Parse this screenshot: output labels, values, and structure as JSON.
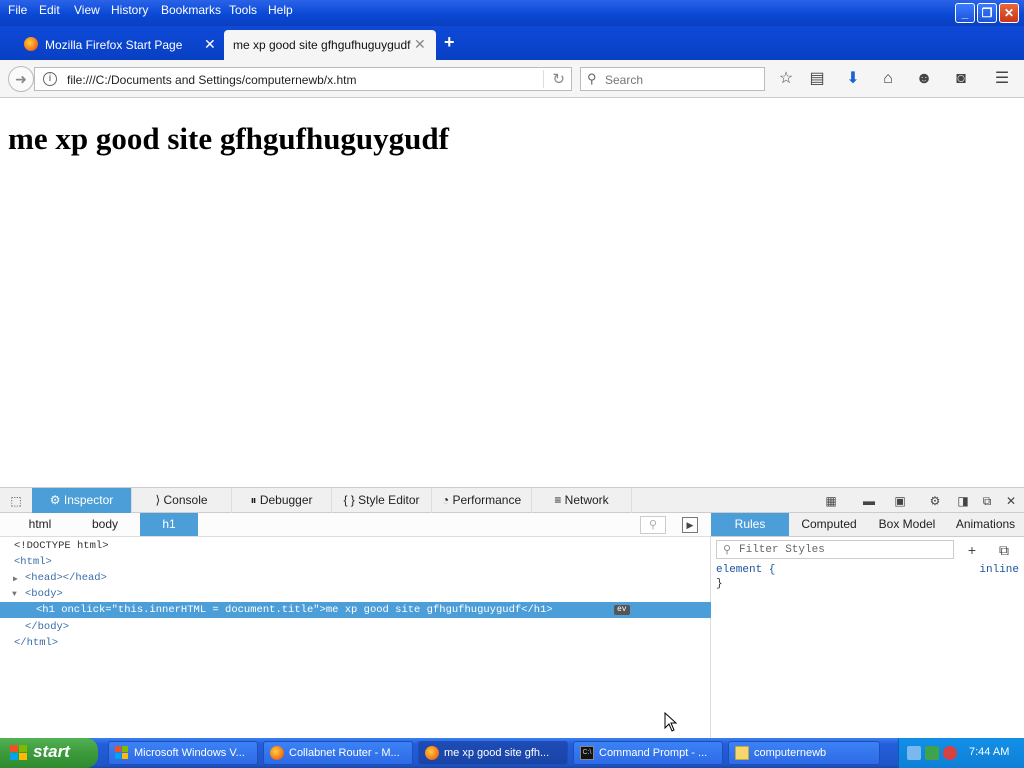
{
  "menu": [
    "File",
    "Edit",
    "View",
    "History",
    "Bookmarks",
    "Tools",
    "Help"
  ],
  "menu_accel": [
    "F",
    "E",
    "V",
    "s",
    "B",
    "T",
    "H"
  ],
  "tabs": [
    {
      "label": "Mozilla Firefox Start Page",
      "active": false
    },
    {
      "label": "me xp good site gfhgufhuguygudf",
      "active": true
    }
  ],
  "nav": {
    "url": "file:///C:/Documents and Settings/computernewb/x.htm",
    "search_placeholder": "Search"
  },
  "page": {
    "heading": "me xp good site gfhgufhuguygudf"
  },
  "devtools": {
    "tabs": [
      "Inspector",
      "Console",
      "Debugger",
      "Style Editor",
      "Performance",
      "Network"
    ],
    "breadcrumbs": [
      "html",
      "body",
      "h1"
    ],
    "markup": {
      "doctype": "<!DOCTYPE html>",
      "html_open": "<html>",
      "head": "<head></head>",
      "body_open": "<body>",
      "h1": "<h1 onclick=\"this.innerHTML = document.title\">me xp good site gfhgufhuguygudf</h1>",
      "ev_badge": "ev",
      "body_close": "</body>",
      "html_close": "</html>"
    },
    "side_tabs": [
      "Rules",
      "Computed",
      "Box Model",
      "Animations"
    ],
    "filter_placeholder": "Filter Styles",
    "rule_selector": "element {",
    "rule_close": "}",
    "rule_source": "inline"
  },
  "taskbar": {
    "start_label": "start",
    "tasks": [
      {
        "label": "Microsoft Windows V...",
        "active": false
      },
      {
        "label": "Collabnet Router - M...",
        "active": false
      },
      {
        "label": "me xp good site gfh...",
        "active": true
      },
      {
        "label": "Command Prompt - ...",
        "active": false
      },
      {
        "label": "computernewb",
        "active": false
      }
    ],
    "clock": "7:44 AM"
  },
  "icons": {
    "back": "back-arrow-icon",
    "info": "info-icon",
    "reload": "reload-icon",
    "search": "search-icon",
    "bookmark": "bookmark-star-icon",
    "reader": "bookmarks-list-icon",
    "download": "download-icon",
    "home": "home-icon",
    "social": "smiley-icon",
    "pocket": "pocket-icon",
    "hamburger": "menu-icon"
  },
  "colors": {
    "xp_blue": "#0a49d6",
    "devtools_accent": "#4c9ed9",
    "start_green": "#3c9a3c"
  }
}
